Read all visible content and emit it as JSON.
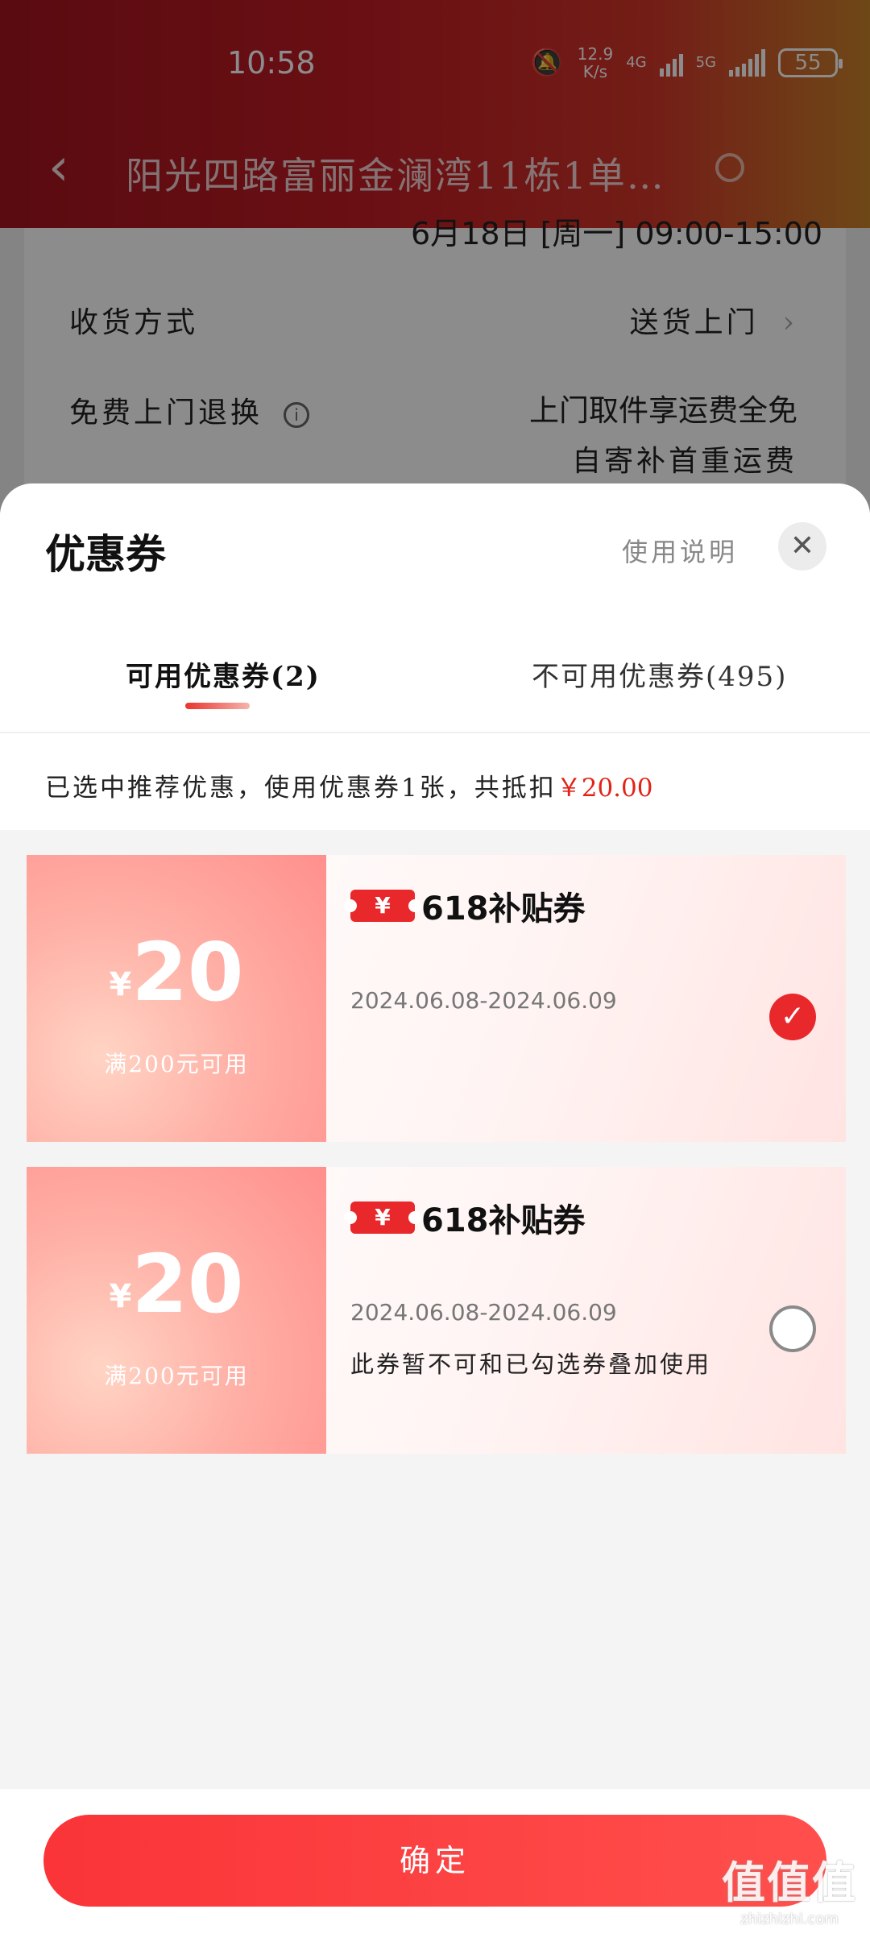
{
  "status_bar": {
    "time": "10:58",
    "net_speed_value": "12.9",
    "net_speed_unit": "K/s",
    "net1": "4G",
    "net2": "5G",
    "battery": "55"
  },
  "nav": {
    "address": "阳光四路富丽金澜湾11栋1单…"
  },
  "background": {
    "partial_delivery_time": "6月18日 [周一] 09:00-15:00",
    "delivery_method_label": "收货方式",
    "delivery_method_value": "送货上门",
    "free_return_label": "免费上门退换",
    "free_return_value_1": "上门取件享运费全免",
    "free_return_value_2": "自寄补首重运费"
  },
  "sheet": {
    "title": "优惠券",
    "usage_link": "使用说明",
    "tabs": [
      {
        "label": "可用优惠券(2)",
        "active": true
      },
      {
        "label": "不可用优惠券(495)",
        "active": false
      }
    ],
    "summary_text": "已选中推荐优惠，使用优惠券1张，共抵扣",
    "summary_amount": "￥20.00"
  },
  "coupons": [
    {
      "currency": "¥",
      "amount": "20",
      "condition": "满200元可用",
      "badge_symbol": "¥",
      "name": "618补贴券",
      "date_range": "2024.06.08-2024.06.09",
      "note": "",
      "selected": true
    },
    {
      "currency": "¥",
      "amount": "20",
      "condition": "满200元可用",
      "badge_symbol": "¥",
      "name": "618补贴券",
      "date_range": "2024.06.08-2024.06.09",
      "note": "此券暂不可和已勾选券叠加使用",
      "selected": false
    }
  ],
  "footer": {
    "confirm_label": "确定"
  },
  "watermark": {
    "logo": "值值值",
    "url": "zhizhizhi.com"
  },
  "colors": {
    "accent": "#e8282a",
    "header": "#c41e25"
  }
}
